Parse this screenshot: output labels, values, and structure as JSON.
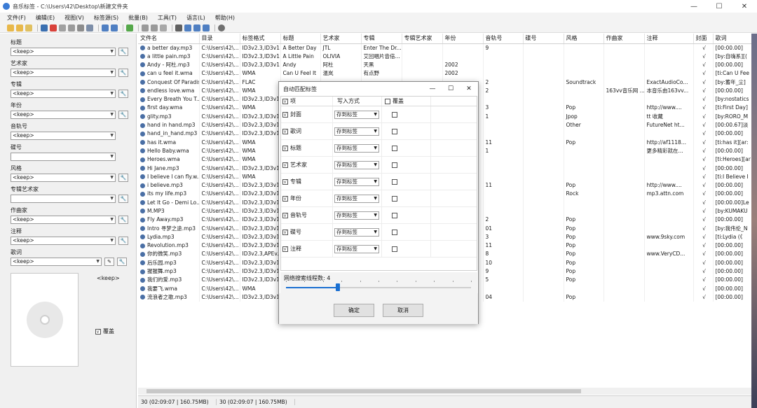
{
  "window": {
    "title": "音乐标签 - C:\\Users\\42\\Desktop\\新建文件夹",
    "controls": [
      "—",
      "☐",
      "✕"
    ]
  },
  "menu": [
    "文件(F)",
    "编辑(E)",
    "视图(V)",
    "标签源(S)",
    "批量(B)",
    "工具(T)",
    "语言(L)",
    "帮助(H)"
  ],
  "left_panel": {
    "fields": [
      {
        "label": "标题",
        "value": "<keep>"
      },
      {
        "label": "艺术家",
        "value": "<keep>"
      },
      {
        "label": "专辑",
        "value": "<keep>"
      },
      {
        "label": "年份",
        "value": "<keep>"
      },
      {
        "label": "音轨号",
        "value": "<keep>"
      },
      {
        "label": "碟号",
        "value": ""
      },
      {
        "label": "风格",
        "value": "<keep>"
      },
      {
        "label": "专辑艺术家",
        "value": ""
      },
      {
        "label": "作曲家",
        "value": "<keep>"
      },
      {
        "label": "注释",
        "value": "<keep>"
      },
      {
        "label": "歌词",
        "value": "<keep>"
      }
    ],
    "cover_text": "<keep>",
    "overwrite_label": "覆盖",
    "overwrite_check": "√"
  },
  "table": {
    "columns": [
      "文件名",
      "目录",
      "标签格式",
      "标题",
      "艺术家",
      "专辑",
      "专辑艺术家",
      "年份",
      "音轨号",
      "碟号",
      "风格",
      "作曲家",
      "注释",
      "封面",
      "歌词"
    ],
    "rows": [
      [
        "a better day.mp3",
        "C:\\Users\\42\\...",
        "ID3v2.3,ID3v1",
        "A Better Day",
        "JTL",
        "Enter The Dr...",
        "",
        "",
        "9",
        "",
        "",
        "",
        "",
        "√",
        "[00:00.00]"
      ],
      [
        "a little pain.mp3",
        "C:\\Users\\42\\...",
        "ID3v2.3,ID3v1",
        "A Little Pain",
        "OLIVIA",
        "艾回唱片音倍...",
        "",
        "",
        "",
        "",
        "",
        "",
        "",
        "√",
        "[by:自嗨系][("
      ],
      [
        "Andy - 阿杜.mp3",
        "C:\\Users\\42\\...",
        "ID3v2.3,ID3v1",
        "Andy",
        "阿杜",
        "天黑",
        "",
        "2002",
        "",
        "",
        "",
        "",
        "",
        "√",
        "[00:00.00]"
      ],
      [
        "can u feel it.wma",
        "C:\\Users\\42\\...",
        "WMA",
        "Can U Feel It",
        "温岚",
        "有点野",
        "",
        "2002",
        "",
        "",
        "",
        "",
        "",
        "√",
        "[ti:Can U Fee"
      ],
      [
        "Conquest Of Paradis...",
        "C:\\Users\\42\\...",
        "FLAC",
        "",
        "",
        "",
        "",
        "",
        "2",
        "",
        "Soundtrack",
        "",
        "ExactAudioCo...",
        "√",
        "[by:蓄年_尘]"
      ],
      [
        "endless love.wma",
        "C:\\Users\\42\\...",
        "WMA",
        "",
        "",
        "",
        "",
        "",
        "2",
        "",
        "",
        "163vv音乐网 ...",
        "本音乐由163vv...",
        "√",
        "[00:00.00]"
      ],
      [
        "Every Breath You T...",
        "C:\\Users\\42\\...",
        "ID3v2.3,ID3v1",
        "",
        "",
        "",
        "",
        "",
        "",
        "",
        "",
        "",
        "",
        "√",
        "[by:nostatics"
      ],
      [
        "first day.wma",
        "C:\\Users\\42\\...",
        "WMA",
        "",
        "",
        "",
        "",
        "",
        "3",
        "",
        "Pop",
        "",
        "http://www....",
        "√",
        "[ti:First Day]"
      ],
      [
        "glity.mp3",
        "C:\\Users\\42\\...",
        "ID3v2.3,ID3v1",
        "",
        "",
        "",
        "",
        "",
        "1",
        "",
        "Jpop",
        "",
        "tt 收藏",
        "√",
        "[by:RORO_M"
      ],
      [
        "hand in hand.mp3",
        "C:\\Users\\42\\...",
        "ID3v2.3,ID3v1",
        "",
        "",
        "",
        "",
        "",
        "",
        "",
        "Other",
        "",
        "FutureNet ht...",
        "√",
        "[00:00.67]淡"
      ],
      [
        "hand_in_hand.mp3",
        "C:\\Users\\42\\...",
        "ID3v2.3,ID3v1",
        "",
        "",
        "",
        "",
        "",
        "",
        "",
        "",
        "",
        "",
        "√",
        "[00:00.00]"
      ],
      [
        "has it.wma",
        "C:\\Users\\42\\...",
        "WMA",
        "",
        "",
        "",
        "",
        "",
        "11",
        "",
        "Pop",
        "",
        "http://af1118...",
        "√",
        "[ti:has it][ar:"
      ],
      [
        "Hello Baby.wma",
        "C:\\Users\\42\\...",
        "WMA",
        "",
        "",
        "",
        "",
        "",
        "1",
        "",
        "",
        "",
        "更多精彩就在...",
        "√",
        "[00:00.00]"
      ],
      [
        "Heroes.wma",
        "C:\\Users\\42\\...",
        "WMA",
        "",
        "",
        "",
        "",
        "",
        "",
        "",
        "",
        "",
        "",
        "√",
        "[ti:Heroes][ar"
      ],
      [
        "Hi Jane.mp3",
        "C:\\Users\\42\\...",
        "ID3v2.3,ID3v1",
        "",
        "",
        "",
        "",
        "",
        "",
        "",
        "",
        "",
        "",
        "√",
        "[00:00.00]"
      ],
      [
        "I believe I can fly.w...",
        "C:\\Users\\42\\...",
        "WMA",
        "",
        "",
        "",
        "",
        "",
        "",
        "",
        "",
        "",
        "",
        "√",
        "[ti:I Believe I"
      ],
      [
        "i believe.mp3",
        "C:\\Users\\42\\...",
        "ID3v2.3,ID3v1",
        "",
        "",
        "",
        "",
        "",
        "11",
        "",
        "Pop",
        "",
        "http://www....",
        "√",
        "[00:00.00]"
      ],
      [
        "its my life.mp3",
        "C:\\Users\\42\\...",
        "ID3v2.3,ID3v1",
        "",
        "",
        "",
        "",
        "",
        "",
        "",
        "Rock",
        "",
        "mp3.attn.com",
        "√",
        "[00:00.00]"
      ],
      [
        "Let It Go - Demi Lo...",
        "C:\\Users\\42\\...",
        "ID3v2.3,ID3v1",
        "",
        "",
        "",
        "",
        "",
        "",
        "",
        "",
        "",
        "",
        "√",
        "[00:00.00]Le"
      ],
      [
        "M.MP3",
        "C:\\Users\\42\\...",
        "ID3v2.3,ID3v1",
        "",
        "",
        "",
        "",
        "",
        "",
        "",
        "",
        "",
        "",
        "√",
        "[by:KUMAKU"
      ],
      [
        "Fly Away.mp3",
        "C:\\Users\\42\\...",
        "ID3v2.3,ID3v1",
        "",
        "",
        "",
        "",
        "",
        "2",
        "",
        "Pop",
        "",
        "",
        "√",
        "[00:00.00]"
      ],
      [
        "Intro 寻梦之途.mp3",
        "C:\\Users\\42\\...",
        "ID3v2.3,ID3v1",
        "",
        "",
        "",
        "",
        "",
        "01",
        "",
        "Pop",
        "",
        "",
        "√",
        "[by:我伟伦_N"
      ],
      [
        "Lydia.mp3",
        "C:\\Users\\42\\...",
        "ID3v2.3,ID3v1",
        "",
        "",
        "",
        "",
        "",
        "3",
        "",
        "Pop",
        "",
        "www.9sky.com",
        "√",
        "[ti:Lydia (《"
      ],
      [
        "Revolution.mp3",
        "C:\\Users\\42\\...",
        "ID3v2.3,ID3v1",
        "",
        "",
        "",
        "",
        "",
        "11",
        "",
        "Pop",
        "",
        "",
        "√",
        "[00:00.00]"
      ],
      [
        "你的微笑.mp3",
        "C:\\Users\\42\\...",
        "ID3v2.3,APEv...",
        "",
        "",
        "",
        "",
        "",
        "8",
        "",
        "Pop",
        "",
        "www.VeryCD...",
        "√",
        "[00:00.00]"
      ],
      [
        "后乐园.mp3",
        "C:\\Users\\42\\...",
        "ID3v2.3,ID3v1",
        "",
        "",
        "",
        "",
        "",
        "10",
        "",
        "Pop",
        "",
        "",
        "√",
        "[00:00.00]"
      ],
      [
        "猩猩舞.mp3",
        "C:\\Users\\42\\...",
        "ID3v2.3,ID3v1",
        "",
        "",
        "",
        "",
        "",
        "9",
        "",
        "Pop",
        "",
        "",
        "√",
        "[00:00.00]"
      ],
      [
        "我们的爱.mp3",
        "C:\\Users\\42\\...",
        "ID3v2.3,ID3v1",
        "",
        "",
        "",
        "",
        "",
        "5",
        "",
        "Pop",
        "",
        "",
        "√",
        "[00:00.00]"
      ],
      [
        "我要飞.wma",
        "C:\\Users\\42\\...",
        "WMA",
        "",
        "",
        "",
        "",
        "",
        "",
        "",
        "",
        "",
        "",
        "√",
        "[00:00.00]"
      ],
      [
        "流浪者之歌.mp3",
        "C:\\Users\\42\\...",
        "ID3v2.3,ID3v1",
        "",
        "",
        "",
        "",
        "",
        "04",
        "",
        "Pop",
        "",
        "",
        "√",
        "[00:00.00]"
      ]
    ]
  },
  "status": {
    "left": "30 (02:09:07 | 160.75MB)",
    "right": "30 (02:09:07 | 160.75MB)"
  },
  "dialog": {
    "title": "自动匹配标签",
    "controls": [
      "—",
      "☐",
      "✕"
    ],
    "head_item": "项",
    "head_write": "写入方式",
    "head_overwrite": "覆盖",
    "rows": [
      {
        "label": "封面",
        "mode": "存到标签"
      },
      {
        "label": "歌词",
        "mode": "存到标签"
      },
      {
        "label": "标题",
        "mode": "存到标签"
      },
      {
        "label": "艺术家",
        "mode": "存到标签"
      },
      {
        "label": "专辑",
        "mode": "存到标签"
      },
      {
        "label": "年份",
        "mode": "存到标签"
      },
      {
        "label": "音轨号",
        "mode": "存到标签"
      },
      {
        "label": "碟号",
        "mode": "存到标签"
      },
      {
        "label": "注释",
        "mode": "存到标签"
      }
    ],
    "thread_label": "网络搜索线程数: 4",
    "thread_level": 0.28,
    "ok": "确定",
    "cancel": "取消",
    "check": "√"
  }
}
